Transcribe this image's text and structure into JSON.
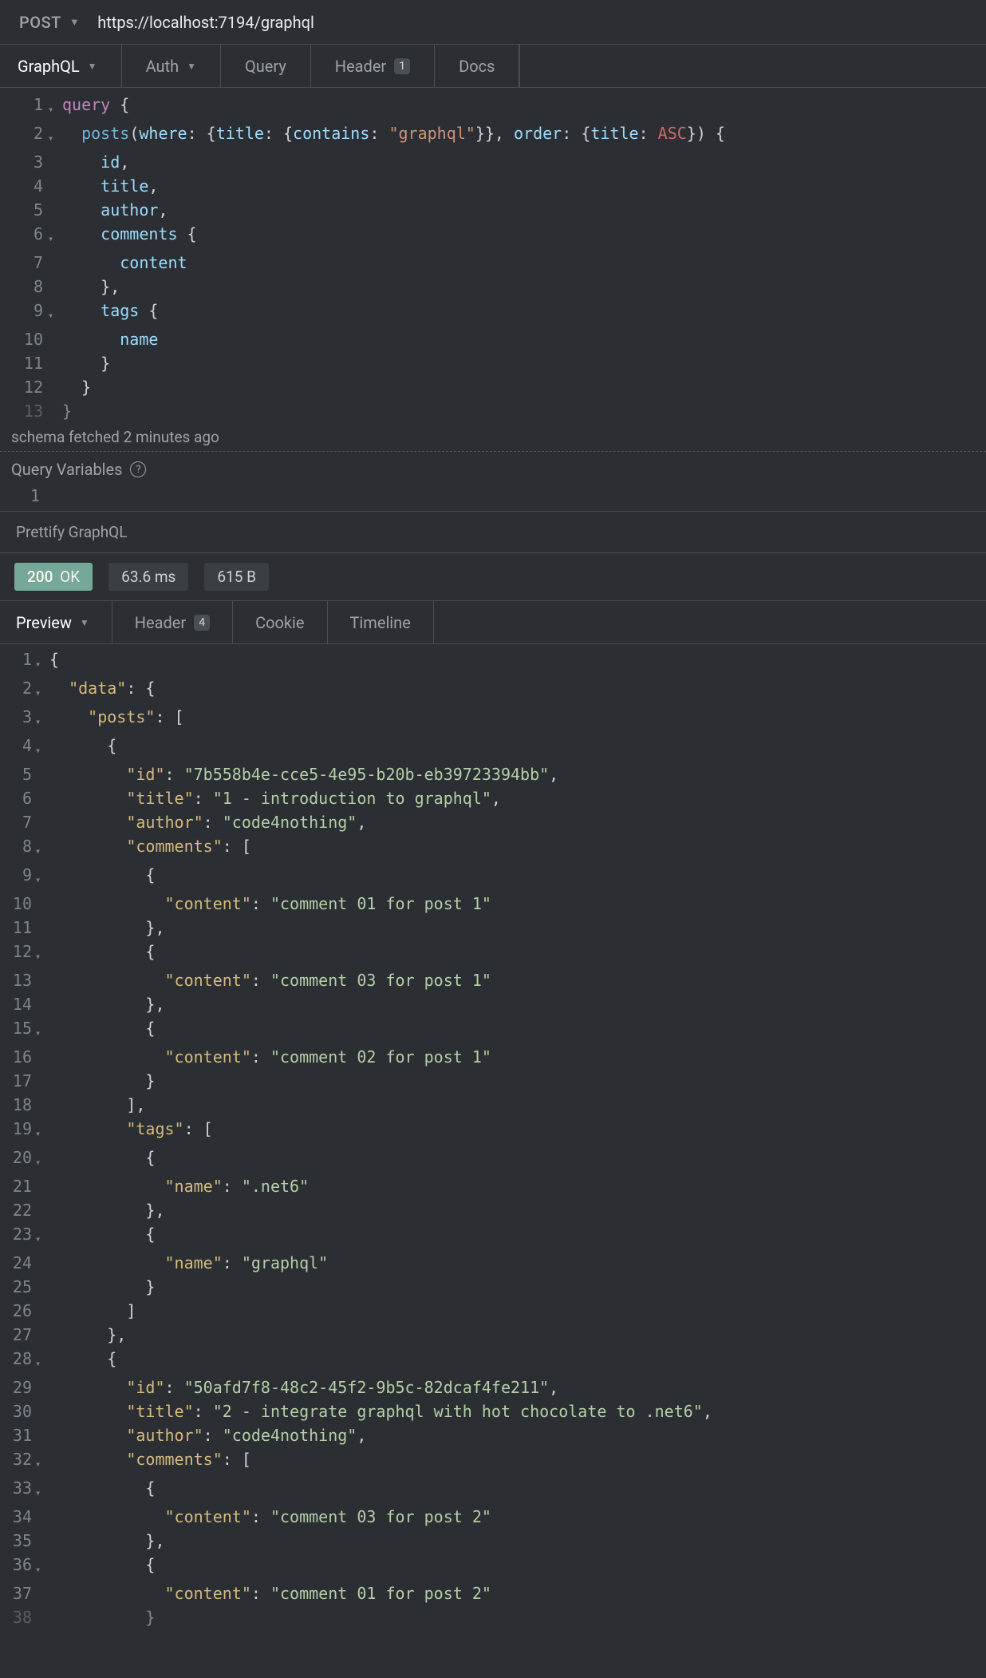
{
  "request": {
    "method": "POST",
    "url": "https://localhost:7194/graphql"
  },
  "reqTabs": {
    "graphql": "GraphQL",
    "auth": "Auth",
    "query": "Query",
    "header": {
      "label": "Header",
      "badge": "1"
    },
    "docs": "Docs"
  },
  "queryLines": [
    {
      "n": "1",
      "fold": "▾",
      "segs": [
        [
          "kw",
          "query"
        ],
        [
          "p",
          " {"
        ]
      ]
    },
    {
      "n": "2",
      "fold": "▾",
      "segs": [
        [
          "p",
          "  "
        ],
        [
          "fn",
          "posts"
        ],
        [
          "p",
          "("
        ],
        [
          "arg",
          "where"
        ],
        [
          "p",
          ": {"
        ],
        [
          "arg",
          "title"
        ],
        [
          "p",
          ": {"
        ],
        [
          "arg",
          "contains"
        ],
        [
          "p",
          ": "
        ],
        [
          "str",
          "\"graphql\""
        ],
        [
          "p",
          "}}, "
        ],
        [
          "arg",
          "order"
        ],
        [
          "p",
          ": {"
        ],
        [
          "arg",
          "title"
        ],
        [
          "p",
          ": "
        ],
        [
          "en",
          "ASC"
        ],
        [
          "p",
          "}) {"
        ]
      ]
    },
    {
      "n": "3",
      "fold": "",
      "segs": [
        [
          "p",
          "    "
        ],
        [
          "fld",
          "id"
        ],
        [
          "p",
          ","
        ]
      ]
    },
    {
      "n": "4",
      "fold": "",
      "segs": [
        [
          "p",
          "    "
        ],
        [
          "fld",
          "title"
        ],
        [
          "p",
          ","
        ]
      ]
    },
    {
      "n": "5",
      "fold": "",
      "segs": [
        [
          "p",
          "    "
        ],
        [
          "fld",
          "author"
        ],
        [
          "p",
          ","
        ]
      ]
    },
    {
      "n": "6",
      "fold": "▾",
      "segs": [
        [
          "p",
          "    "
        ],
        [
          "fld",
          "comments"
        ],
        [
          "p",
          " {"
        ]
      ]
    },
    {
      "n": "7",
      "fold": "",
      "segs": [
        [
          "p",
          "      "
        ],
        [
          "fld",
          "content"
        ]
      ]
    },
    {
      "n": "8",
      "fold": "",
      "segs": [
        [
          "p",
          "    },"
        ]
      ]
    },
    {
      "n": "9",
      "fold": "▾",
      "segs": [
        [
          "p",
          "    "
        ],
        [
          "fld",
          "tags"
        ],
        [
          "p",
          " {"
        ]
      ]
    },
    {
      "n": "10",
      "fold": "",
      "segs": [
        [
          "p",
          "      "
        ],
        [
          "fld",
          "name"
        ]
      ]
    },
    {
      "n": "11",
      "fold": "",
      "segs": [
        [
          "p",
          "    }"
        ]
      ]
    },
    {
      "n": "12",
      "fold": "",
      "segs": [
        [
          "p",
          "  }"
        ]
      ]
    },
    {
      "n": "13",
      "fold": "",
      "fade": true,
      "segs": [
        [
          "p",
          "}"
        ]
      ]
    }
  ],
  "schemaStatus": "schema fetched 2 minutes ago",
  "queryVarsLabel": "Query Variables",
  "queryVarsLine": "1",
  "prettifyLabel": "Prettify GraphQL",
  "response": {
    "status": {
      "code": "200",
      "text": "OK"
    },
    "time": "63.6 ms",
    "size": "615 B"
  },
  "respTabs": {
    "preview": "Preview",
    "header": {
      "label": "Header",
      "badge": "4"
    },
    "cookie": "Cookie",
    "timeline": "Timeline"
  },
  "respLines": [
    {
      "n": "1",
      "fold": "▾",
      "segs": [
        [
          "p",
          "{"
        ]
      ]
    },
    {
      "n": "2",
      "fold": "▾",
      "segs": [
        [
          "p",
          "  "
        ],
        [
          "jk",
          "\"data\""
        ],
        [
          "p",
          ": {"
        ]
      ]
    },
    {
      "n": "3",
      "fold": "▾",
      "segs": [
        [
          "p",
          "    "
        ],
        [
          "jk",
          "\"posts\""
        ],
        [
          "p",
          ": ["
        ]
      ]
    },
    {
      "n": "4",
      "fold": "▾",
      "segs": [
        [
          "p",
          "      {"
        ]
      ]
    },
    {
      "n": "5",
      "fold": "",
      "segs": [
        [
          "p",
          "        "
        ],
        [
          "jk",
          "\"id\""
        ],
        [
          "p",
          ": "
        ],
        [
          "js",
          "\"7b558b4e-cce5-4e95-b20b-eb39723394bb\""
        ],
        [
          "p",
          ","
        ]
      ]
    },
    {
      "n": "6",
      "fold": "",
      "segs": [
        [
          "p",
          "        "
        ],
        [
          "jk",
          "\"title\""
        ],
        [
          "p",
          ": "
        ],
        [
          "js",
          "\"1 - introduction to graphql\""
        ],
        [
          "p",
          ","
        ]
      ]
    },
    {
      "n": "7",
      "fold": "",
      "segs": [
        [
          "p",
          "        "
        ],
        [
          "jk",
          "\"author\""
        ],
        [
          "p",
          ": "
        ],
        [
          "js",
          "\"code4nothing\""
        ],
        [
          "p",
          ","
        ]
      ]
    },
    {
      "n": "8",
      "fold": "▾",
      "segs": [
        [
          "p",
          "        "
        ],
        [
          "jk",
          "\"comments\""
        ],
        [
          "p",
          ": ["
        ]
      ]
    },
    {
      "n": "9",
      "fold": "▾",
      "segs": [
        [
          "p",
          "          {"
        ]
      ]
    },
    {
      "n": "10",
      "fold": "",
      "segs": [
        [
          "p",
          "            "
        ],
        [
          "jk",
          "\"content\""
        ],
        [
          "p",
          ": "
        ],
        [
          "js",
          "\"comment 01 for post 1\""
        ]
      ]
    },
    {
      "n": "11",
      "fold": "",
      "segs": [
        [
          "p",
          "          },"
        ]
      ]
    },
    {
      "n": "12",
      "fold": "▾",
      "segs": [
        [
          "p",
          "          {"
        ]
      ]
    },
    {
      "n": "13",
      "fold": "",
      "segs": [
        [
          "p",
          "            "
        ],
        [
          "jk",
          "\"content\""
        ],
        [
          "p",
          ": "
        ],
        [
          "js",
          "\"comment 03 for post 1\""
        ]
      ]
    },
    {
      "n": "14",
      "fold": "",
      "segs": [
        [
          "p",
          "          },"
        ]
      ]
    },
    {
      "n": "15",
      "fold": "▾",
      "segs": [
        [
          "p",
          "          {"
        ]
      ]
    },
    {
      "n": "16",
      "fold": "",
      "segs": [
        [
          "p",
          "            "
        ],
        [
          "jk",
          "\"content\""
        ],
        [
          "p",
          ": "
        ],
        [
          "js",
          "\"comment 02 for post 1\""
        ]
      ]
    },
    {
      "n": "17",
      "fold": "",
      "segs": [
        [
          "p",
          "          }"
        ]
      ]
    },
    {
      "n": "18",
      "fold": "",
      "segs": [
        [
          "p",
          "        ],"
        ]
      ]
    },
    {
      "n": "19",
      "fold": "▾",
      "segs": [
        [
          "p",
          "        "
        ],
        [
          "jk",
          "\"tags\""
        ],
        [
          "p",
          ": ["
        ]
      ]
    },
    {
      "n": "20",
      "fold": "▾",
      "segs": [
        [
          "p",
          "          {"
        ]
      ]
    },
    {
      "n": "21",
      "fold": "",
      "segs": [
        [
          "p",
          "            "
        ],
        [
          "jk",
          "\"name\""
        ],
        [
          "p",
          ": "
        ],
        [
          "js",
          "\".net6\""
        ]
      ]
    },
    {
      "n": "22",
      "fold": "",
      "segs": [
        [
          "p",
          "          },"
        ]
      ]
    },
    {
      "n": "23",
      "fold": "▾",
      "segs": [
        [
          "p",
          "          {"
        ]
      ]
    },
    {
      "n": "24",
      "fold": "",
      "segs": [
        [
          "p",
          "            "
        ],
        [
          "jk",
          "\"name\""
        ],
        [
          "p",
          ": "
        ],
        [
          "js",
          "\"graphql\""
        ]
      ]
    },
    {
      "n": "25",
      "fold": "",
      "segs": [
        [
          "p",
          "          }"
        ]
      ]
    },
    {
      "n": "26",
      "fold": "",
      "segs": [
        [
          "p",
          "        ]"
        ]
      ]
    },
    {
      "n": "27",
      "fold": "",
      "segs": [
        [
          "p",
          "      },"
        ]
      ]
    },
    {
      "n": "28",
      "fold": "▾",
      "segs": [
        [
          "p",
          "      {"
        ]
      ]
    },
    {
      "n": "29",
      "fold": "",
      "segs": [
        [
          "p",
          "        "
        ],
        [
          "jk",
          "\"id\""
        ],
        [
          "p",
          ": "
        ],
        [
          "js",
          "\"50afd7f8-48c2-45f2-9b5c-82dcaf4fe211\""
        ],
        [
          "p",
          ","
        ]
      ]
    },
    {
      "n": "30",
      "fold": "",
      "segs": [
        [
          "p",
          "        "
        ],
        [
          "jk",
          "\"title\""
        ],
        [
          "p",
          ": "
        ],
        [
          "js",
          "\"2 - integrate graphql with hot chocolate to .net6\""
        ],
        [
          "p",
          ","
        ]
      ]
    },
    {
      "n": "31",
      "fold": "",
      "segs": [
        [
          "p",
          "        "
        ],
        [
          "jk",
          "\"author\""
        ],
        [
          "p",
          ": "
        ],
        [
          "js",
          "\"code4nothing\""
        ],
        [
          "p",
          ","
        ]
      ]
    },
    {
      "n": "32",
      "fold": "▾",
      "segs": [
        [
          "p",
          "        "
        ],
        [
          "jk",
          "\"comments\""
        ],
        [
          "p",
          ": ["
        ]
      ]
    },
    {
      "n": "33",
      "fold": "▾",
      "segs": [
        [
          "p",
          "          {"
        ]
      ]
    },
    {
      "n": "34",
      "fold": "",
      "segs": [
        [
          "p",
          "            "
        ],
        [
          "jk",
          "\"content\""
        ],
        [
          "p",
          ": "
        ],
        [
          "js",
          "\"comment 03 for post 2\""
        ]
      ]
    },
    {
      "n": "35",
      "fold": "",
      "segs": [
        [
          "p",
          "          },"
        ]
      ]
    },
    {
      "n": "36",
      "fold": "▾",
      "segs": [
        [
          "p",
          "          {"
        ]
      ]
    },
    {
      "n": "37",
      "fold": "",
      "segs": [
        [
          "p",
          "            "
        ],
        [
          "jk",
          "\"content\""
        ],
        [
          "p",
          ": "
        ],
        [
          "js",
          "\"comment 01 for post 2\""
        ]
      ]
    },
    {
      "n": "38",
      "fold": "",
      "fade": true,
      "segs": [
        [
          "p",
          "          }"
        ]
      ]
    }
  ]
}
